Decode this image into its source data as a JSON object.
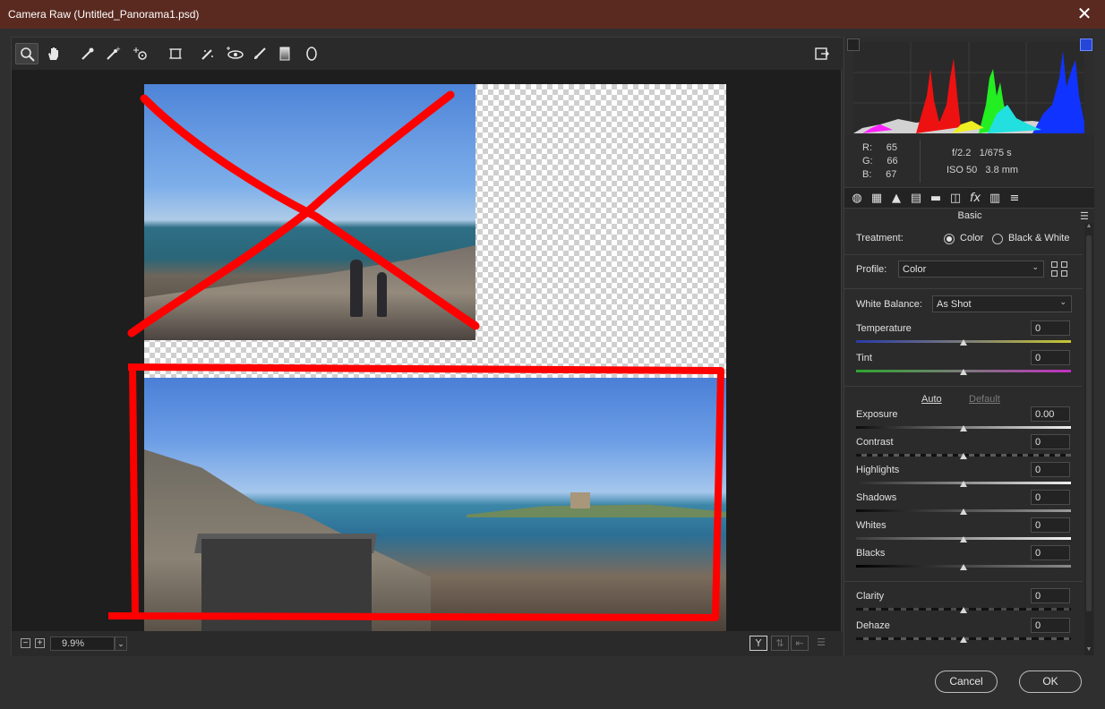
{
  "window": {
    "title": "Camera Raw (Untitled_Panorama1.psd)",
    "close_glyph": "✕"
  },
  "toolbar": {
    "tools": [
      {
        "name": "zoom-tool-icon",
        "glyph": "🔍",
        "active": true
      },
      {
        "name": "hand-tool-icon",
        "glyph": "✋"
      },
      {
        "name": "white-balance-eyedropper-icon",
        "glyph": "✎"
      },
      {
        "name": "color-sampler-icon",
        "glyph": "✐"
      },
      {
        "name": "targeted-adjustment-icon",
        "glyph": "⊹"
      },
      {
        "name": "transform-tool-icon",
        "glyph": "⌗"
      },
      {
        "name": "spot-removal-icon",
        "glyph": "✄"
      },
      {
        "name": "red-eye-removal-icon",
        "glyph": "◉"
      },
      {
        "name": "adjustment-brush-icon",
        "glyph": "🖌"
      },
      {
        "name": "graduated-filter-icon",
        "glyph": "▮"
      },
      {
        "name": "radial-filter-icon",
        "glyph": "◯"
      }
    ],
    "fullscreen_glyph": "⇱"
  },
  "statusbar": {
    "zoom_out": "−",
    "zoom_in": "+",
    "zoom_value": "9.9%",
    "zoom_caret": "⌄",
    "before_after_label": "Y",
    "swap_glyph": "⇅",
    "copy_glyph": "⇤",
    "settings_glyph": "☰"
  },
  "histogram": {
    "r": "65",
    "g": "66",
    "b": "67",
    "r_label": "R:",
    "g_label": "G:",
    "b_label": "B:",
    "aperture": "f/2.2",
    "shutter": "1/675 s",
    "iso": "ISO 50",
    "focal": "3.8 mm"
  },
  "panel_tabs": [
    {
      "name": "basic-tab-icon",
      "glyph": "◍"
    },
    {
      "name": "tone-curve-tab-icon",
      "glyph": "▦"
    },
    {
      "name": "detail-tab-icon",
      "glyph": "▲"
    },
    {
      "name": "hsl-tab-icon",
      "glyph": "▤"
    },
    {
      "name": "split-toning-tab-icon",
      "glyph": "▬"
    },
    {
      "name": "lens-corrections-tab-icon",
      "glyph": "◫"
    },
    {
      "name": "effects-tab-icon",
      "glyph": "fx"
    },
    {
      "name": "camera-calibration-tab-icon",
      "glyph": "▥"
    },
    {
      "name": "presets-tab-icon",
      "glyph": "≡"
    }
  ],
  "basic": {
    "title": "Basic",
    "menu_glyph": "☰",
    "treatment_label": "Treatment:",
    "treatment_color": "Color",
    "treatment_bw": "Black & White",
    "profile_label": "Profile:",
    "profile_value": "Color",
    "wb_label": "White Balance:",
    "wb_value": "As Shot",
    "auto": "Auto",
    "default": "Default",
    "sliders": {
      "temperature": {
        "label": "Temperature",
        "value": "0"
      },
      "tint": {
        "label": "Tint",
        "value": "0"
      },
      "exposure": {
        "label": "Exposure",
        "value": "0.00"
      },
      "contrast": {
        "label": "Contrast",
        "value": "0"
      },
      "highlights": {
        "label": "Highlights",
        "value": "0"
      },
      "shadows": {
        "label": "Shadows",
        "value": "0"
      },
      "whites": {
        "label": "Whites",
        "value": "0"
      },
      "blacks": {
        "label": "Blacks",
        "value": "0"
      },
      "clarity": {
        "label": "Clarity",
        "value": "0"
      },
      "dehaze": {
        "label": "Dehaze",
        "value": "0"
      }
    }
  },
  "buttons": {
    "cancel": "Cancel",
    "ok": "OK"
  },
  "colors": {
    "annotation_red": "#ff0000",
    "titlebar": "#5a2a20",
    "link_active": "#d8d8d8",
    "link_dim": "#7a7a7a"
  }
}
